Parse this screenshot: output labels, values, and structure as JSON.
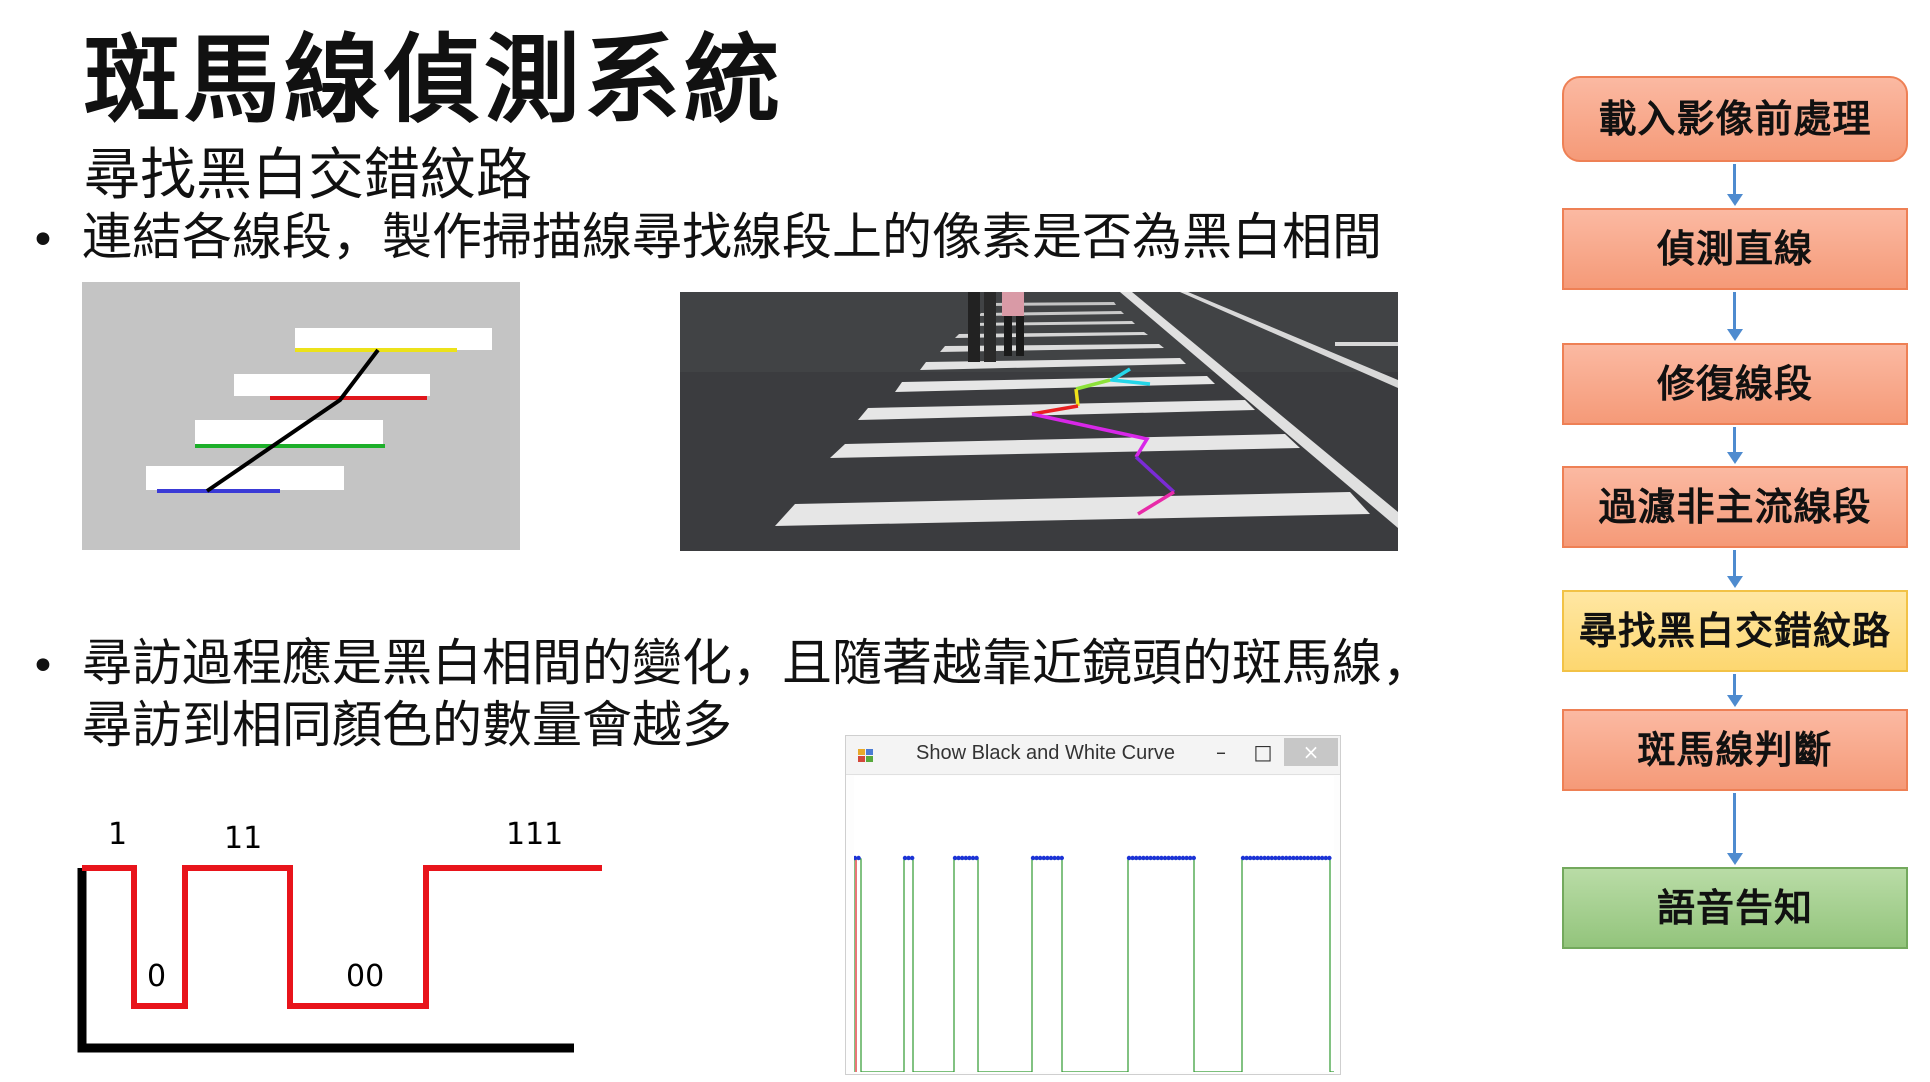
{
  "slide": {
    "title": "斑馬線偵測系統",
    "subtitle": "尋找黑白交錯紋路",
    "bullets": [
      {
        "lines": [
          "連結各線段，製作掃描線尋找線段上的像素是否為黑白相間"
        ]
      },
      {
        "lines": [
          "尋訪過程應是黑白相間的變化，且隨著越靠近鏡頭的斑馬線，",
          "尋訪到相同顏色的數量會越多"
        ]
      }
    ],
    "bullet_symbol": "•"
  },
  "flow": {
    "steps": [
      {
        "label": "載入影像前處理",
        "color": "#f59a78"
      },
      {
        "label": "偵測直線",
        "color": "#f59a78"
      },
      {
        "label": "修復線段",
        "color": "#f59a78"
      },
      {
        "label": "過濾非主流線段",
        "color": "#f59a78"
      },
      {
        "label": "尋找黑白交錯紋路",
        "color": "#fdd770"
      },
      {
        "label": "斑馬線判斷",
        "color": "#f59a78"
      },
      {
        "label": "語音告知",
        "color": "#93c47c"
      }
    ],
    "arrow_color": "#4e8bcf"
  },
  "scan_diagram": {
    "background": "#c4c4c4",
    "segment_colors": [
      "#3a3ad6",
      "#1daf2a",
      "#e0161c",
      "#ece21a"
    ],
    "scanline_color": "#000000"
  },
  "window": {
    "title": "Show Black and White Curve",
    "minimize_glyph": "–",
    "maximize_glyph": "□",
    "close_glyph": "×",
    "app_icon": "window-app-icon",
    "curve_color": "#2f9a2f",
    "marker_color": "#1c33d6"
  },
  "signal_diagram": {
    "run_labels": [
      "1",
      "0",
      "11",
      "00",
      "111"
    ],
    "wave_color": "#e8141b",
    "axis_color": "#000000"
  }
}
